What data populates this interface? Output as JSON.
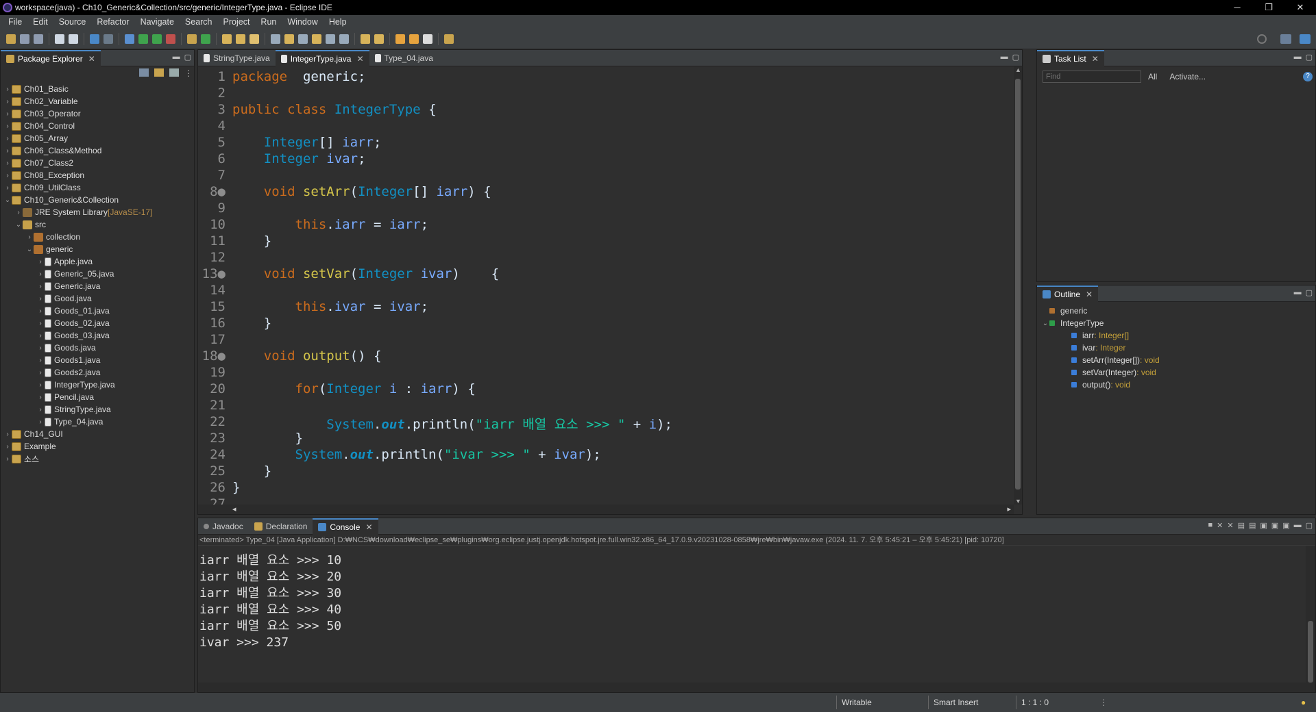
{
  "window": {
    "title": "workspace(java) - Ch10_Generic&Collection/src/generic/IntegerType.java - Eclipse IDE",
    "minimize": "─",
    "maximize": "❐",
    "close": "✕"
  },
  "menu": [
    "File",
    "Edit",
    "Source",
    "Refactor",
    "Navigate",
    "Search",
    "Project",
    "Run",
    "Window",
    "Help"
  ],
  "package_explorer": {
    "title": "Package Explorer",
    "items": [
      {
        "label": "Ch01_Basic",
        "level": 0,
        "arrow": "›",
        "kind": "proj"
      },
      {
        "label": "Ch02_Variable",
        "level": 0,
        "arrow": "›",
        "kind": "proj"
      },
      {
        "label": "Ch03_Operator",
        "level": 0,
        "arrow": "›",
        "kind": "proj"
      },
      {
        "label": "Ch04_Control",
        "level": 0,
        "arrow": "›",
        "kind": "proj"
      },
      {
        "label": "Ch05_Array",
        "level": 0,
        "arrow": "›",
        "kind": "proj"
      },
      {
        "label": "Ch06_Class&Method",
        "level": 0,
        "arrow": "›",
        "kind": "proj"
      },
      {
        "label": "Ch07_Class2",
        "level": 0,
        "arrow": "›",
        "kind": "proj"
      },
      {
        "label": "Ch08_Exception",
        "level": 0,
        "arrow": "›",
        "kind": "proj"
      },
      {
        "label": "Ch09_UtilClass",
        "level": 0,
        "arrow": "›",
        "kind": "proj"
      },
      {
        "label": "Ch10_Generic&Collection",
        "level": 0,
        "arrow": "⌄",
        "kind": "proj"
      },
      {
        "label": "JRE System Library",
        "suffix": " [JavaSE-17]",
        "level": 1,
        "arrow": "›",
        "kind": "lib"
      },
      {
        "label": "src",
        "level": 1,
        "arrow": "⌄",
        "kind": "src"
      },
      {
        "label": "collection",
        "level": 2,
        "arrow": "›",
        "kind": "pkg"
      },
      {
        "label": "generic",
        "level": 2,
        "arrow": "⌄",
        "kind": "pkg"
      },
      {
        "label": "Apple.java",
        "level": 3,
        "arrow": "›",
        "kind": "jf"
      },
      {
        "label": "Generic_05.java",
        "level": 3,
        "arrow": "›",
        "kind": "jf"
      },
      {
        "label": "Generic.java",
        "level": 3,
        "arrow": "›",
        "kind": "jf"
      },
      {
        "label": "Good.java",
        "level": 3,
        "arrow": "›",
        "kind": "jf"
      },
      {
        "label": "Goods_01.java",
        "level": 3,
        "arrow": "›",
        "kind": "jf"
      },
      {
        "label": "Goods_02.java",
        "level": 3,
        "arrow": "›",
        "kind": "jf"
      },
      {
        "label": "Goods_03.java",
        "level": 3,
        "arrow": "›",
        "kind": "jf"
      },
      {
        "label": "Goods.java",
        "level": 3,
        "arrow": "›",
        "kind": "jf"
      },
      {
        "label": "Goods1.java",
        "level": 3,
        "arrow": "›",
        "kind": "jf"
      },
      {
        "label": "Goods2.java",
        "level": 3,
        "arrow": "›",
        "kind": "jf"
      },
      {
        "label": "IntegerType.java",
        "level": 3,
        "arrow": "›",
        "kind": "jf"
      },
      {
        "label": "Pencil.java",
        "level": 3,
        "arrow": "›",
        "kind": "jf"
      },
      {
        "label": "StringType.java",
        "level": 3,
        "arrow": "›",
        "kind": "jf"
      },
      {
        "label": "Type_04.java",
        "level": 3,
        "arrow": "›",
        "kind": "jf"
      },
      {
        "label": "Ch14_GUI",
        "level": 0,
        "arrow": "›",
        "kind": "proj"
      },
      {
        "label": "Example",
        "level": 0,
        "arrow": "›",
        "kind": "proj"
      },
      {
        "label": "소스",
        "level": 0,
        "arrow": "›",
        "kind": "proj"
      }
    ]
  },
  "editor": {
    "tabs": [
      {
        "label": "StringType.java",
        "active": false
      },
      {
        "label": "IntegerType.java",
        "active": true
      },
      {
        "label": "Type_04.java",
        "active": false
      }
    ],
    "lines": [
      {
        "n": "1",
        "tokens": [
          [
            "kw",
            "package"
          ],
          [
            "",
            "  generic;"
          ]
        ]
      },
      {
        "n": "2",
        "tokens": []
      },
      {
        "n": "3",
        "tokens": [
          [
            "kw",
            "public"
          ],
          [
            "",
            " "
          ],
          [
            "kw",
            "class"
          ],
          [
            "",
            " "
          ],
          [
            "cls",
            "IntegerType"
          ],
          [
            "",
            " {"
          ]
        ]
      },
      {
        "n": "4",
        "tokens": []
      },
      {
        "n": "5",
        "tokens": [
          [
            "",
            "    "
          ],
          [
            "ty",
            "Integer"
          ],
          [
            "",
            "[] "
          ],
          [
            "vr",
            "iarr"
          ],
          [
            "",
            ";"
          ]
        ]
      },
      {
        "n": "6",
        "tokens": [
          [
            "",
            "    "
          ],
          [
            "ty",
            "Integer"
          ],
          [
            "",
            " "
          ],
          [
            "vr",
            "ivar"
          ],
          [
            "",
            ";"
          ]
        ]
      },
      {
        "n": "7",
        "tokens": []
      },
      {
        "n": "8●",
        "tokens": [
          [
            "",
            "    "
          ],
          [
            "kw",
            "void"
          ],
          [
            "",
            " "
          ],
          [
            "fn",
            "setArr"
          ],
          [
            "",
            "("
          ],
          [
            "ty",
            "Integer"
          ],
          [
            "",
            "[] "
          ],
          [
            "vr",
            "iarr"
          ],
          [
            "",
            ") {"
          ]
        ]
      },
      {
        "n": "9",
        "tokens": []
      },
      {
        "n": "10",
        "tokens": [
          [
            "",
            "        "
          ],
          [
            "kw",
            "this"
          ],
          [
            "",
            "."
          ],
          [
            "vr",
            "iarr"
          ],
          [
            "",
            " = "
          ],
          [
            "vr",
            "iarr"
          ],
          [
            "",
            ";"
          ]
        ]
      },
      {
        "n": "11",
        "tokens": [
          [
            "",
            "    }"
          ]
        ]
      },
      {
        "n": "12",
        "tokens": []
      },
      {
        "n": "13●",
        "tokens": [
          [
            "",
            "    "
          ],
          [
            "kw",
            "void"
          ],
          [
            "",
            " "
          ],
          [
            "fn",
            "setVar"
          ],
          [
            "",
            "("
          ],
          [
            "ty",
            "Integer"
          ],
          [
            "",
            " "
          ],
          [
            "vr",
            "ivar"
          ],
          [
            "",
            ")    {"
          ]
        ]
      },
      {
        "n": "14",
        "tokens": []
      },
      {
        "n": "15",
        "tokens": [
          [
            "",
            "        "
          ],
          [
            "kw",
            "this"
          ],
          [
            "",
            "."
          ],
          [
            "vr",
            "ivar"
          ],
          [
            "",
            " = "
          ],
          [
            "vr",
            "ivar"
          ],
          [
            "",
            ";"
          ]
        ]
      },
      {
        "n": "16",
        "tokens": [
          [
            "",
            "    }"
          ]
        ]
      },
      {
        "n": "17",
        "tokens": []
      },
      {
        "n": "18●",
        "tokens": [
          [
            "",
            "    "
          ],
          [
            "kw",
            "void"
          ],
          [
            "",
            " "
          ],
          [
            "fn",
            "output"
          ],
          [
            "",
            "() {"
          ]
        ]
      },
      {
        "n": "19",
        "tokens": []
      },
      {
        "n": "20",
        "tokens": [
          [
            "",
            "        "
          ],
          [
            "kw",
            "for"
          ],
          [
            "",
            "("
          ],
          [
            "ty",
            "Integer"
          ],
          [
            "",
            " "
          ],
          [
            "vr",
            "i"
          ],
          [
            "",
            " : "
          ],
          [
            "vr",
            "iarr"
          ],
          [
            "",
            ") {"
          ]
        ]
      },
      {
        "n": "21",
        "tokens": []
      },
      {
        "n": "22",
        "tokens": [
          [
            "",
            "            "
          ],
          [
            "cls",
            "System"
          ],
          [
            "",
            "."
          ],
          [
            "so",
            "out"
          ],
          [
            "",
            ".println("
          ],
          [
            "st",
            "\"iarr 배열 요소 >>> \""
          ],
          [
            "",
            " + "
          ],
          [
            "vr",
            "i"
          ],
          [
            "",
            ");"
          ]
        ]
      },
      {
        "n": "23",
        "tokens": [
          [
            "",
            "        }"
          ]
        ]
      },
      {
        "n": "24",
        "tokens": [
          [
            "",
            "        "
          ],
          [
            "cls",
            "System"
          ],
          [
            "",
            "."
          ],
          [
            "so",
            "out"
          ],
          [
            "",
            ".println("
          ],
          [
            "st",
            "\"ivar >>> \""
          ],
          [
            "",
            " + "
          ],
          [
            "vr",
            "ivar"
          ],
          [
            "",
            ");"
          ]
        ]
      },
      {
        "n": "25",
        "tokens": [
          [
            "",
            "    }"
          ]
        ]
      },
      {
        "n": "26",
        "tokens": [
          [
            "",
            "}"
          ]
        ]
      },
      {
        "n": "27",
        "tokens": []
      }
    ]
  },
  "task_list": {
    "title": "Task List",
    "find_placeholder": "Find",
    "all_label": "All",
    "activate_label": "Activate..."
  },
  "outline": {
    "title": "Outline",
    "items": [
      {
        "label": "generic",
        "type": "",
        "level": 0,
        "icon": "#b07030"
      },
      {
        "label": "IntegerType",
        "type": "",
        "level": 0,
        "icon": "#2e9e4a",
        "arrow": "⌄"
      },
      {
        "label": "iarr",
        "type": " : Integer[]",
        "level": 1,
        "icon": "#3b7dd8"
      },
      {
        "label": "ivar",
        "type": " : Integer",
        "level": 1,
        "icon": "#3b7dd8"
      },
      {
        "label": "setArr(Integer[])",
        "type": " : void",
        "level": 1,
        "icon": "#3b7dd8"
      },
      {
        "label": "setVar(Integer)",
        "type": " : void",
        "level": 1,
        "icon": "#3b7dd8"
      },
      {
        "label": "output()",
        "type": " : void",
        "level": 1,
        "icon": "#3b7dd8"
      }
    ]
  },
  "console": {
    "tabs": [
      {
        "label": "Javadoc",
        "active": false
      },
      {
        "label": "Declaration",
        "active": false
      },
      {
        "label": "Console",
        "active": true
      }
    ],
    "status": "<terminated> Type_04 [Java Application] D:₩NCS₩download₩eclipse_se₩plugins₩org.eclipse.justj.openjdk.hotspot.jre.full.win32.x86_64_17.0.9.v20231028-0858₩jre₩bin₩javaw.exe  (2024. 11. 7. 오후 5:45:21 – 오후 5:45:21) [pid: 10720]",
    "output": "iarr 배열 요소 >>> 10\niarr 배열 요소 >>> 20\niarr 배열 요소 >>> 30\niarr 배열 요소 >>> 40\niarr 배열 요소 >>> 50\nivar >>> 237"
  },
  "statusbar": {
    "writable": "Writable",
    "insert_mode": "Smart Insert",
    "position": "1 : 1 : 0"
  },
  "colors": {
    "keyword": "#cc6c1d",
    "type": "#1290c3",
    "string": "#17c6a3",
    "method": "#d4c54a",
    "field": "#79abff",
    "accent": "#4a88c7"
  }
}
